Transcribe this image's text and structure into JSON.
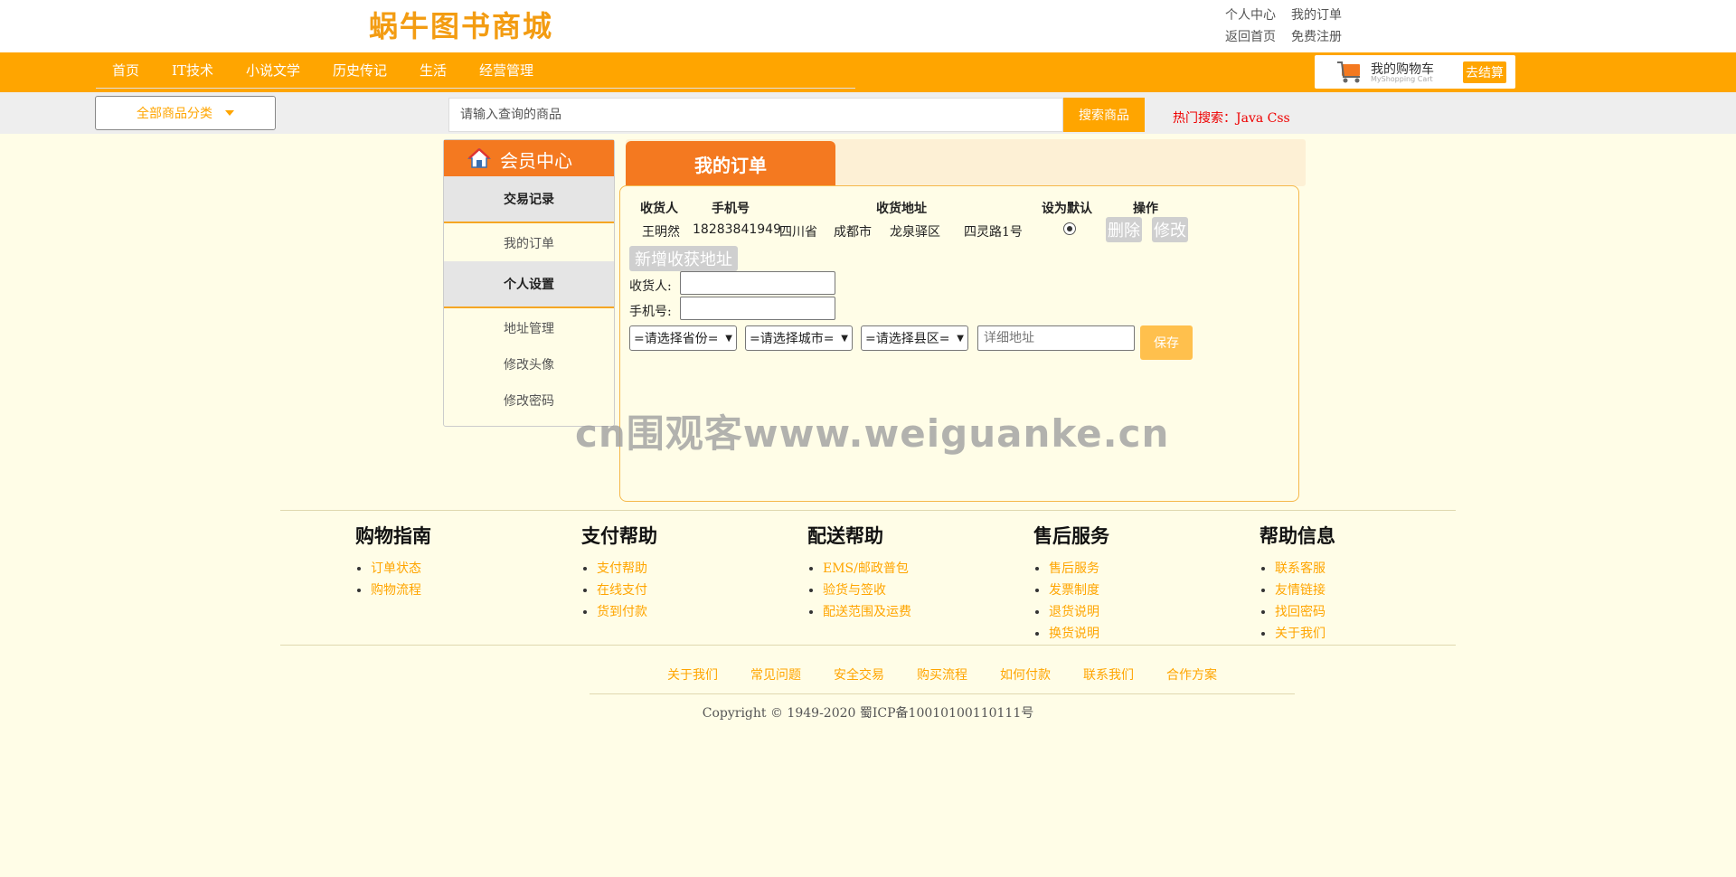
{
  "header": {
    "logo": "蜗牛图书商城",
    "links_row1": [
      "个人中心",
      "我的订单"
    ],
    "links_row2": [
      "返回首页",
      "免费注册"
    ]
  },
  "nav": {
    "items": [
      "首页",
      "IT技术",
      "小说文学",
      "历史传记",
      "生活",
      "经营管理"
    ],
    "cart_label": "我的购物车",
    "cart_sub": "MyShopping Cart",
    "checkout": "去结算"
  },
  "search": {
    "category_label": "全部商品分类",
    "placeholder": "请输入查询的商品",
    "button": "搜索商品",
    "hot": "热门搜索：Java Css"
  },
  "sidebar": {
    "title": "会员中心",
    "section1": "交易记录",
    "link_orders": "我的订单",
    "section2": "个人设置",
    "link_address": "地址管理",
    "link_avatar": "修改头像",
    "link_password": "修改密码"
  },
  "content": {
    "tab_title": "我的订单",
    "table_headers": [
      "收货人",
      "手机号",
      "收货地址",
      "设为默认",
      "操作"
    ],
    "row": {
      "name": "王明然",
      "phone": "18283841949",
      "province": "四川省",
      "city": "成都市",
      "district": "龙泉驿区",
      "street": "四灵路1号"
    },
    "delete_btn": "删除",
    "edit_btn": "修改",
    "add_address_btn": "新增收获地址",
    "form": {
      "receiver_label": "收货人:",
      "phone_label": "手机号:",
      "province_select": "=请选择省份=",
      "city_select": "=请选择城市=",
      "district_select": "=请选择县区=",
      "detail_placeholder": "详细地址",
      "save_btn": "保存"
    }
  },
  "watermark": "cn围观客www.weiguanke.cn",
  "help": [
    {
      "title": "购物指南",
      "items": [
        "订单状态",
        "购物流程"
      ]
    },
    {
      "title": "支付帮助",
      "items": [
        "支付帮助",
        "在线支付",
        "货到付款"
      ]
    },
    {
      "title": "配送帮助",
      "items": [
        "EMS/邮政普包",
        "验货与签收",
        "配送范围及运费"
      ]
    },
    {
      "title": "售后服务",
      "items": [
        "售后服务",
        "发票制度",
        "退货说明",
        "换货说明"
      ]
    },
    {
      "title": "帮助信息",
      "items": [
        "联系客服",
        "友情链接",
        "找回密码",
        "关于我们"
      ]
    }
  ],
  "footer_links": [
    "关于我们",
    "常见问题",
    "安全交易",
    "购买流程",
    "如何付款",
    "联系我们",
    "合作方案"
  ],
  "copyright": "Copyright © 1949-2020 蜀ICP备10010100110111号",
  "colors": {
    "accent": "#ffa500",
    "tab": "#f47920",
    "page_bg": "#fffde7"
  }
}
